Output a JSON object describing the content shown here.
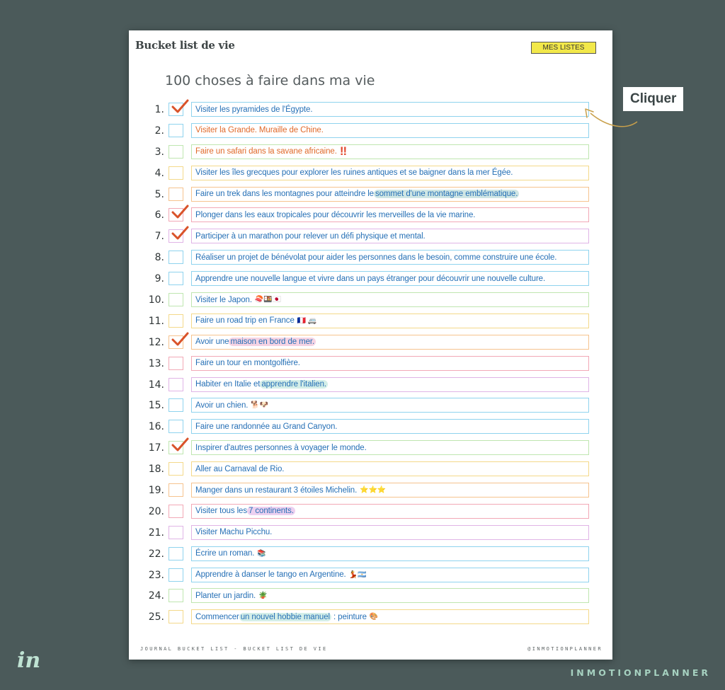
{
  "header": {
    "title": "Bucket list de vie",
    "lists_button": "MES LISTES"
  },
  "subtitle": "100 choses à faire dans ma vie",
  "colors": {
    "checkmark": "#d9532a",
    "blue": "#8fd3ee",
    "yellow": "#f4d98a",
    "green": "#bfe6b0",
    "orange": "#f6c38e",
    "pink": "#f2a8b6",
    "purple": "#e0b4e6"
  },
  "items": [
    {
      "number": "1.",
      "text": "Visiter les pyramides de l'Égypte.",
      "checked": true,
      "color": "#8fd3ee",
      "text_color": "#2670b6",
      "icon": "checkmark-icon"
    },
    {
      "number": "2.",
      "text": "Visiter la Grande. Muraille de Chine.",
      "checked": false,
      "color": "#8fd3ee",
      "text_color": "#e06a2b"
    },
    {
      "number": "3.",
      "text": "Faire un safari dans la savane africaine.",
      "checked": false,
      "color": "#bfe6b0",
      "text_color": "#e06a2b",
      "suffix": "‼",
      "suffix_color": "#e24a2f"
    },
    {
      "number": "4.",
      "text": "Visiter les îles grecques pour explorer les ruines antiques et se baigner dans la mer Égée.",
      "checked": false,
      "color": "#f4d98a",
      "text_color": "#2670b6"
    },
    {
      "number": "5.",
      "text": "Faire un trek dans les montagnes pour atteindre le",
      "highlight": "sommet d'une montagne emblématique.",
      "highlight_color": "#cfe6e4",
      "checked": false,
      "color": "#f6c38e",
      "text_color": "#2670b6"
    },
    {
      "number": "6.",
      "text": "Plonger dans les eaux tropicales pour découvrir les merveilles de la vie marine.",
      "checked": true,
      "color": "#f2a8b6",
      "text_color": "#2670b6"
    },
    {
      "number": "7.",
      "text": "Participer à un marathon pour relever un défi physique et mental.",
      "checked": true,
      "color": "#e0b4e6",
      "text_color": "#2670b6"
    },
    {
      "number": "8.",
      "text": "Réaliser un projet de bénévolat pour aider les personnes dans le besoin, comme construire une école.",
      "checked": false,
      "color": "#8fd3ee",
      "text_color": "#2670b6"
    },
    {
      "number": "9.",
      "text": "Apprendre une nouvelle langue et vivre dans un pays étranger pour découvrir une nouvelle culture.",
      "checked": false,
      "color": "#8fd3ee",
      "text_color": "#2670b6"
    },
    {
      "number": "10.",
      "text": "Visiter le Japon.",
      "suffix": "🍣🍱🇯🇵",
      "checked": false,
      "color": "#bfe6b0",
      "text_color": "#2670b6"
    },
    {
      "number": "11.",
      "text": "Faire un road trip en France",
      "suffix": "🇫🇷 🚐",
      "checked": false,
      "color": "#f4d98a",
      "text_color": "#2670b6"
    },
    {
      "number": "12.",
      "text": "Avoir une",
      "highlight": "maison en bord de mer.",
      "highlight_color": "#f6d3e3",
      "checked": true,
      "color": "#f6c38e",
      "text_color": "#2670b6"
    },
    {
      "number": "13.",
      "text": "Faire un tour en montgolfière.",
      "checked": false,
      "color": "#f2a8b6",
      "text_color": "#2670b6"
    },
    {
      "number": "14.",
      "text": "Habiter en Italie et",
      "highlight": "apprendre l'italien.",
      "highlight_color": "#d4eee8",
      "checked": false,
      "color": "#e0b4e6",
      "text_color": "#2670b6"
    },
    {
      "number": "15.",
      "text": "Avoir un chien.",
      "suffix": "🐕🐶",
      "checked": false,
      "color": "#8fd3ee",
      "text_color": "#2670b6"
    },
    {
      "number": "16.",
      "text": "Faire une randonnée au Grand Canyon.",
      "checked": false,
      "color": "#8fd3ee",
      "text_color": "#2670b6"
    },
    {
      "number": "17.",
      "text": "Inspirer d'autres personnes à voyager le monde.",
      "checked": true,
      "color": "#bfe6b0",
      "text_color": "#2670b6"
    },
    {
      "number": "18.",
      "text": "Aller au Carnaval de Rio.",
      "checked": false,
      "color": "#f4d98a",
      "text_color": "#2670b6"
    },
    {
      "number": "19.",
      "text": "Manger dans un restaurant 3 étoiles Michelin.",
      "suffix": "⭐⭐⭐",
      "checked": false,
      "color": "#f6c38e",
      "text_color": "#2670b6"
    },
    {
      "number": "20.",
      "text": "Visiter tous les",
      "highlight": "7 continents.",
      "highlight_color": "#ecd0f0",
      "checked": false,
      "color": "#f2a8b6",
      "text_color": "#2670b6"
    },
    {
      "number": "21.",
      "text": "Visiter Machu Picchu.",
      "checked": false,
      "color": "#e0b4e6",
      "text_color": "#2670b6"
    },
    {
      "number": "22.",
      "text": "Écrire un roman.",
      "suffix": "📚",
      "checked": false,
      "color": "#8fd3ee",
      "text_color": "#2670b6"
    },
    {
      "number": "23.",
      "text": "Apprendre à danser le tango en Argentine.",
      "suffix": "💃🇦🇷",
      "checked": false,
      "color": "#8fd3ee",
      "text_color": "#2670b6"
    },
    {
      "number": "24.",
      "text": "Planter un jardin.",
      "suffix": "🪴",
      "checked": false,
      "color": "#bfe6b0",
      "text_color": "#2670b6"
    },
    {
      "number": "25.",
      "text": "Commencer",
      "highlight": "un nouvel hobbie manuel",
      "highlight_color": "#d4eee8",
      "after": ": peinture",
      "suffix": "🎨",
      "checked": false,
      "color": "#f4d98a",
      "text_color": "#2670b6"
    }
  ],
  "footer": {
    "left": "JOURNAL BUCKET LIST - BUCKET LIST DE VIE",
    "right": "@INMOTIONPLANNER"
  },
  "callout": {
    "label": "Cliquer"
  },
  "brand": {
    "logo": "in",
    "name": "INMOTIONPLANNER"
  }
}
